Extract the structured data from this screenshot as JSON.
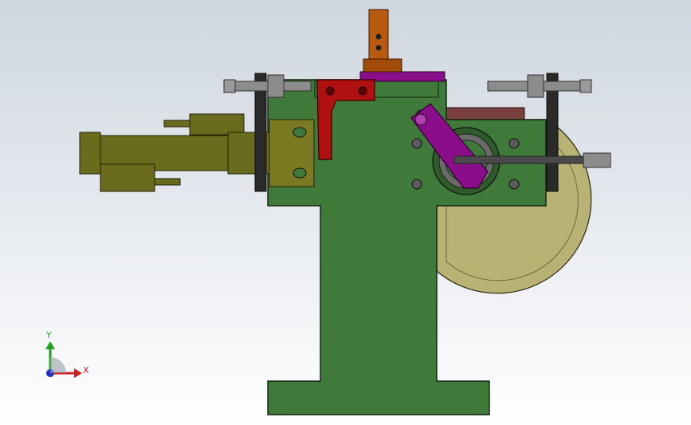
{
  "viewport": {
    "background_top": "#cfd6df",
    "background_bottom": "#ffffff"
  },
  "model": {
    "colors": {
      "base_green": "#3f7a3a",
      "cylinder_olive": "#6b6b1e",
      "red_bracket": "#b01010",
      "purple_link": "#8a0e8a",
      "top_rail_brown": "#7a3f3f",
      "wheel_tan": "#b8b274",
      "orange_tab": "#b85a10",
      "bolt_gray": "#8c8c8c"
    },
    "parts": [
      "base-pedestal",
      "pneumatic-cylinder",
      "red-bracket",
      "purple-link-arm",
      "top-rail",
      "disc-wheel",
      "orange-tab",
      "left-stop-bolt",
      "right-stop-bolt"
    ]
  },
  "triad": {
    "x_label": "X",
    "y_label": "Y",
    "x_color": "#cc2020",
    "y_color": "#20a020",
    "z_color": "#2030c0"
  }
}
